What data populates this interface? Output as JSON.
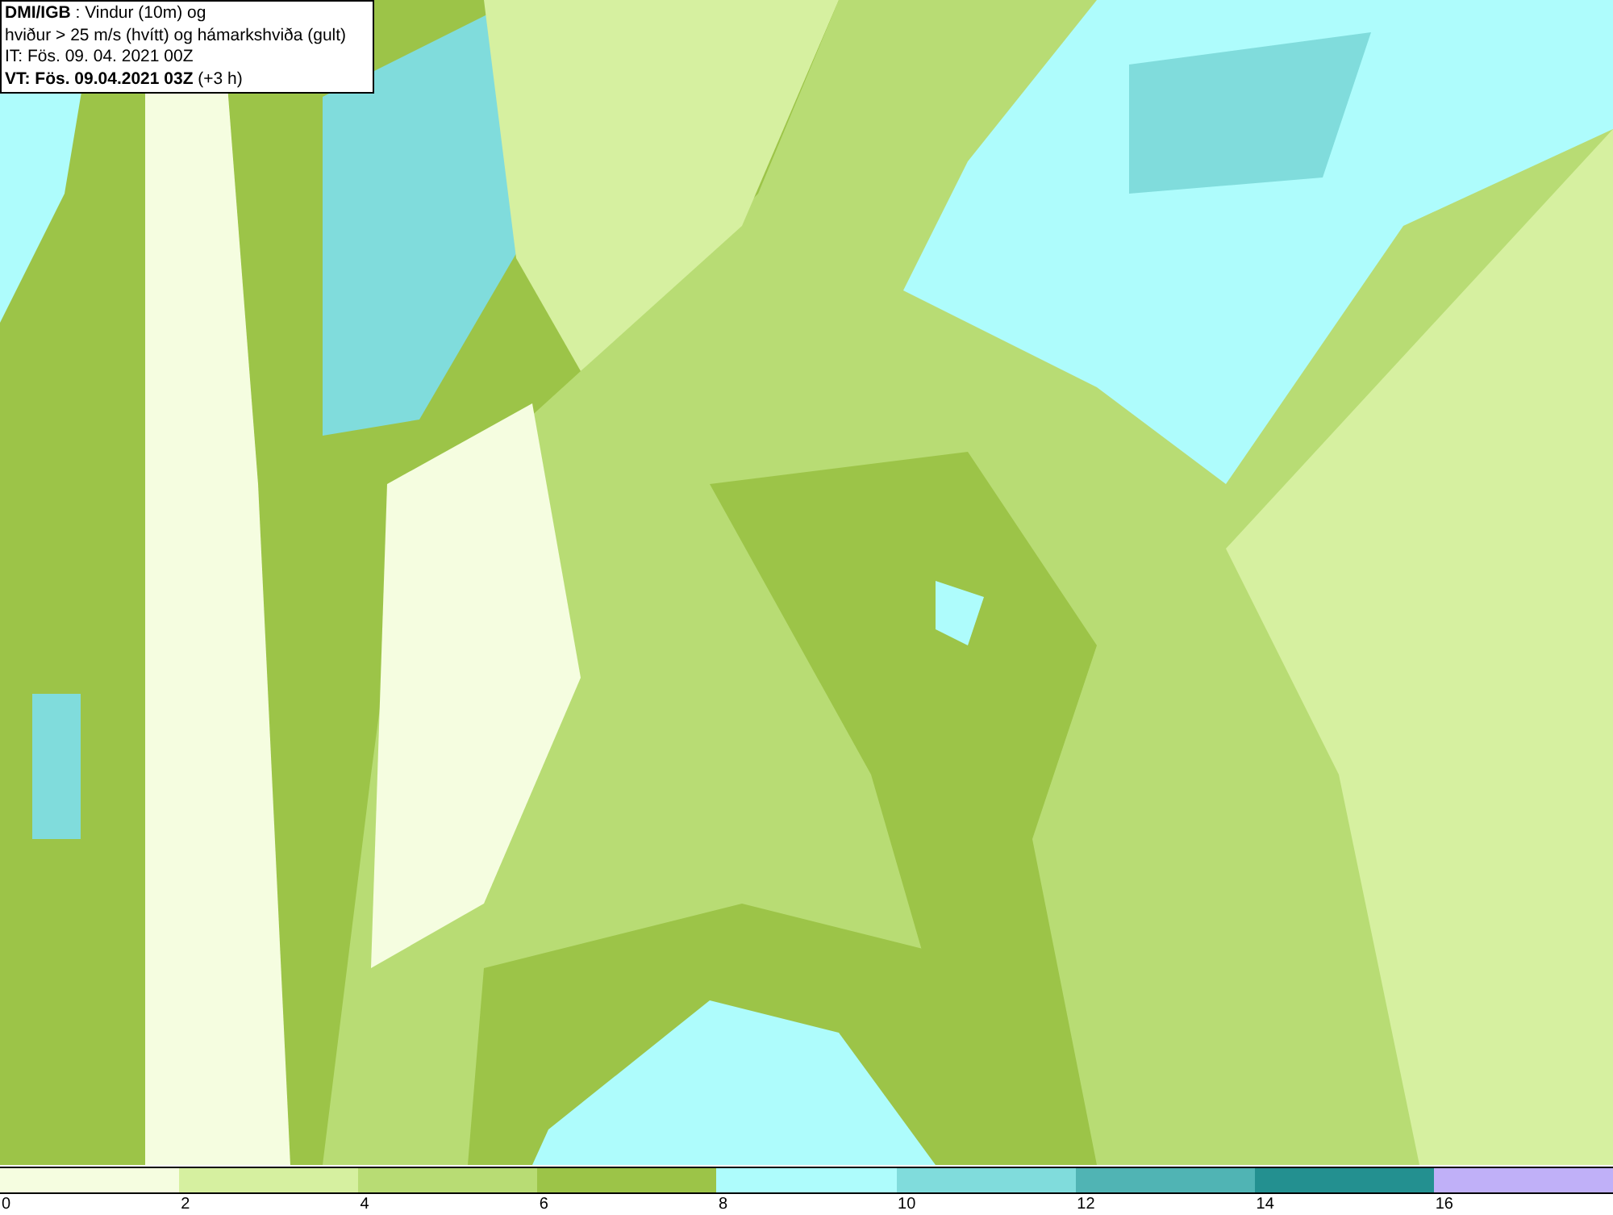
{
  "info_box": {
    "lines": [
      "**DMI/IGB** : Vindur (10m) og",
      "hviður > 25 m/s (hvítt) og hámarkshviða (gult)",
      "IT: Fös. 09. 04. 2021 00Z",
      "**VT: Fös. 09.04.2021 03Z** (+3 h)"
    ]
  },
  "legend": {
    "segments": [
      {
        "color": "#f5fde0"
      },
      {
        "color": "#d6f0a0"
      },
      {
        "color": "#b8dc74"
      },
      {
        "color": "#9cc448"
      },
      {
        "color": "#aefcfc"
      },
      {
        "color": "#80dcdc"
      },
      {
        "color": "#50b4b4"
      },
      {
        "color": "#239090"
      },
      {
        "color": "#c0b0f8"
      }
    ],
    "ticks": [
      "0",
      "2",
      "4",
      "6",
      "8",
      "10",
      "12",
      "14",
      "16"
    ]
  }
}
